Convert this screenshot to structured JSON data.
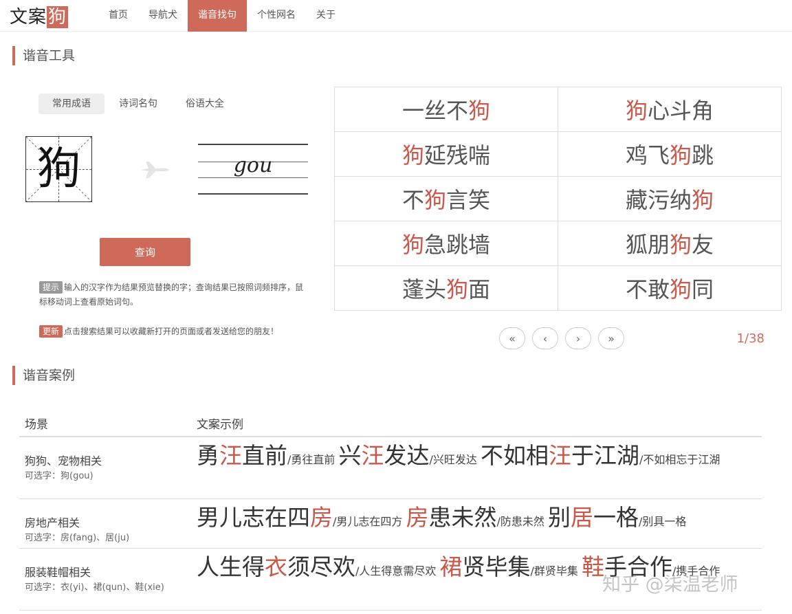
{
  "header": {
    "logo_text": "文案",
    "logo_highlight": "狗",
    "nav": [
      "首页",
      "导航犬",
      "谐音找句",
      "个性网名",
      "关于"
    ],
    "active_index": 2
  },
  "tool": {
    "title": "谐音工具",
    "tabs": [
      "常用成语",
      "诗词名句",
      "俗语大全"
    ],
    "active_tab": 0,
    "input_char": "狗",
    "pinyin": "gou",
    "query_label": "查询",
    "tip_badge": "提示",
    "tip_text": "输入的汉字作为结果预览替换的字；查询结果已按照词频排序，鼠标移动词上查看原始词句。",
    "update_badge": "更新",
    "update_text": "点击搜索结果可以收藏新打开的页面或者发送给您的朋友！"
  },
  "results": [
    [
      {
        "pre": "一丝不",
        "hl": "狗",
        "post": ""
      },
      {
        "pre": "",
        "hl": "狗",
        "post": "心斗角"
      }
    ],
    [
      {
        "pre": "",
        "hl": "狗",
        "post": "延残喘"
      },
      {
        "pre": "鸡飞",
        "hl": "狗",
        "post": "跳"
      }
    ],
    [
      {
        "pre": "不",
        "hl": "狗",
        "post": "言笑"
      },
      {
        "pre": "藏污纳",
        "hl": "狗",
        "post": ""
      }
    ],
    [
      {
        "pre": "",
        "hl": "狗",
        "post": "急跳墙"
      },
      {
        "pre": "狐朋",
        "hl": "狗",
        "post": "友"
      }
    ],
    [
      {
        "pre": "蓬头",
        "hl": "狗",
        "post": "面"
      },
      {
        "pre": "不敢",
        "hl": "狗",
        "post": "同"
      }
    ]
  ],
  "pager": {
    "buttons": [
      "«",
      "‹",
      "›",
      "»"
    ],
    "page": "1/38"
  },
  "cases": {
    "title": "谐音案例",
    "col_scene": "场景",
    "col_example": "文案示例",
    "rows": [
      {
        "scene": "狗狗、宠物相关",
        "options": "可选字：狗(gou)",
        "items": [
          {
            "pre": "勇",
            "hl": "汪",
            "post": "直前",
            "orig": "/勇往直前"
          },
          {
            "pre": "兴",
            "hl": "汪",
            "post": "发达",
            "orig": "/兴旺发达"
          },
          {
            "pre": "不如相",
            "hl": "汪",
            "post": "于江湖",
            "orig": "/不如相忘于江湖"
          }
        ]
      },
      {
        "scene": "房地产相关",
        "options": "可选字：房(fang)、居(ju)",
        "items": [
          {
            "pre": "男儿志在四",
            "hl": "房",
            "post": "",
            "orig": "/男儿志在四方"
          },
          {
            "pre": "",
            "hl": "房",
            "post": "患未然",
            "orig": "/防患未然"
          },
          {
            "pre": "别",
            "hl": "居",
            "post": "一格",
            "orig": "/别具一格"
          }
        ]
      },
      {
        "scene": "服装鞋帽相关",
        "options": "可选字：衣(yi)、裙(qun)、鞋(xie)",
        "items": [
          {
            "pre": "人生得",
            "hl": "衣",
            "post": "须尽欢",
            "orig": "/人生得意需尽欢"
          },
          {
            "pre": "",
            "hl": "裙",
            "post": "贤毕集",
            "orig": "/群贤毕集"
          },
          {
            "pre": "",
            "hl": "鞋",
            "post": "手合作",
            "orig": "/携手合作"
          }
        ]
      }
    ]
  },
  "watermark": "知乎 @柒温老师",
  "colors": {
    "accent": "#cf6a5a",
    "highlight": "#c9584a"
  }
}
